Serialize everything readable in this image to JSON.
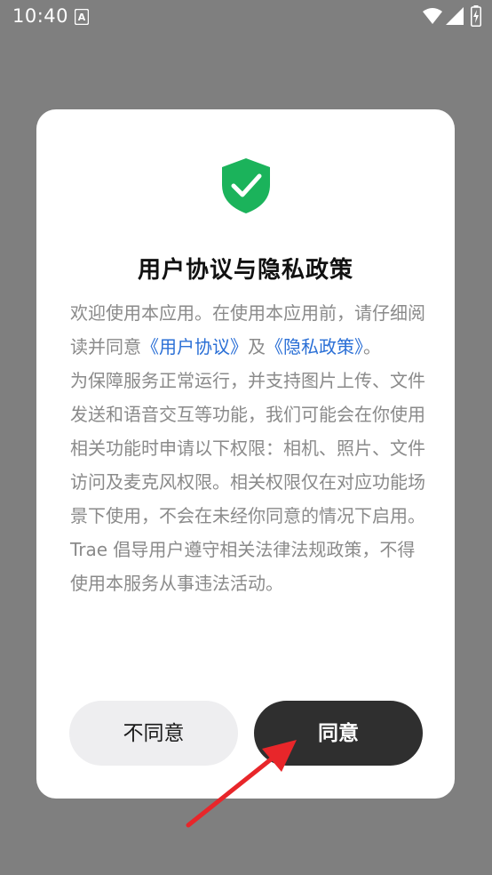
{
  "status_bar": {
    "time": "10:40",
    "icons": [
      "a-icon",
      "wifi-icon",
      "signal-icon",
      "battery-icon"
    ]
  },
  "dialog": {
    "icon": "shield-check-icon",
    "title": "用户协议与隐私政策",
    "intro_prefix": "欢迎使用本应用。在使用本应用前，请仔细阅读并同意",
    "user_agreement_link": "《用户协议》",
    "conjunction": "及",
    "privacy_policy_link": "《隐私政策》",
    "intro_suffix": "。",
    "permissions_text": "为保障服务正常运行，并支持图片上传、文件发送和语音交互等功能，我们可能会在你使用相关功能时申请以下权限：相机、照片、文件访问及麦克风权限。相关权限仅在对应功能场景下使用，不会在未经你同意的情况下启用。",
    "legal_text": "Trae 倡导用户遵守相关法律法规政策，不得使用本服务从事违法活动。",
    "disagree_label": "不同意",
    "agree_label": "同意"
  },
  "colors": {
    "overlay": "#7f7f7f",
    "shield": "#1bb35b",
    "link": "#2a6fd6",
    "agree_button": "#2f2f2f",
    "disagree_button": "#eeeef0",
    "arrow": "#e8262a"
  }
}
